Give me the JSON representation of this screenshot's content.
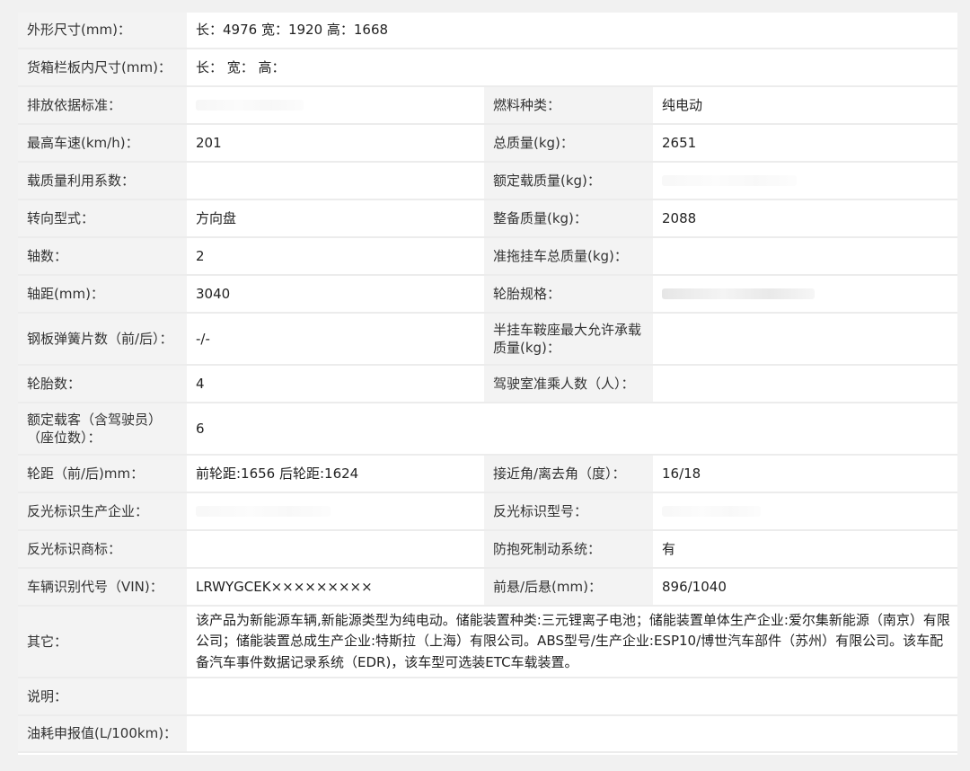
{
  "rows": [
    {
      "type": "full",
      "label": "外形尺寸(mm)：",
      "value": "长：4976 宽：1920 高：1668"
    },
    {
      "type": "full",
      "label": "货箱栏板内尺寸(mm)：",
      "value": "长：  宽：  高："
    },
    {
      "type": "pair",
      "label": "排放依据标准：",
      "value": "",
      "label2": "燃料种类：",
      "value2": "纯电动"
    },
    {
      "type": "pair",
      "label": "最高车速(km/h)：",
      "value": "201",
      "label2": "总质量(kg)：",
      "value2": "2651"
    },
    {
      "type": "pair",
      "label": "载质量利用系数：",
      "value": "",
      "label2": "额定载质量(kg)：",
      "value2": ""
    },
    {
      "type": "pair",
      "label": "转向型式：",
      "value": "方向盘",
      "label2": "整备质量(kg)：",
      "value2": "2088"
    },
    {
      "type": "pair",
      "label": "轴数：",
      "value": "2",
      "label2": "准拖挂车总质量(kg)：",
      "value2": ""
    },
    {
      "type": "pair",
      "label": "轴距(mm)：",
      "value": "3040",
      "label2": "轮胎规格：",
      "value2": ""
    },
    {
      "type": "pair",
      "label": "钢板弹簧片数（前/后）：",
      "value": "-/-",
      "label2": "半挂车鞍座最大允许承载质量(kg)：",
      "value2": ""
    },
    {
      "type": "pair",
      "label": "轮胎数：",
      "value": "4",
      "label2": "驾驶室准乘人数（人）：",
      "value2": ""
    },
    {
      "type": "full",
      "label": "额定载客（含驾驶员）（座位数）：",
      "value": "6"
    },
    {
      "type": "pair",
      "label": "轮距（前/后)mm：",
      "value": "前轮距:1656 后轮距:1624",
      "label2": "接近角/离去角（度）：",
      "value2": "16/18"
    },
    {
      "type": "pair",
      "label": "反光标识生产企业：",
      "value": "",
      "label2": "反光标识型号：",
      "value2": ""
    },
    {
      "type": "pair",
      "label": "反光标识商标：",
      "value": "",
      "label2": "防抱死制动系统：",
      "value2": "有"
    },
    {
      "type": "pair",
      "label": "车辆识别代号（VIN)：",
      "value": "LRWYGCEK×××××××××",
      "label2": "前悬/后悬(mm)：",
      "value2": "896/1040"
    },
    {
      "type": "full",
      "label": "其它：",
      "value": "该产品为新能源车辆,新能源类型为纯电动。储能装置种类:三元锂离子电池；储能装置单体生产企业:爱尔集新能源（南京）有限公司；储能装置总成生产企业:特斯拉（上海）有限公司。ABS型号/生产企业:ESP10/博世汽车部件（苏州）有限公司。该车配备汽车事件数据记录系统（EDR)，该车型可选装ETC车载装置。"
    },
    {
      "type": "full",
      "label": "说明：",
      "value": ""
    },
    {
      "type": "full",
      "label": "油耗申报值(L/100km)：",
      "value": ""
    }
  ]
}
